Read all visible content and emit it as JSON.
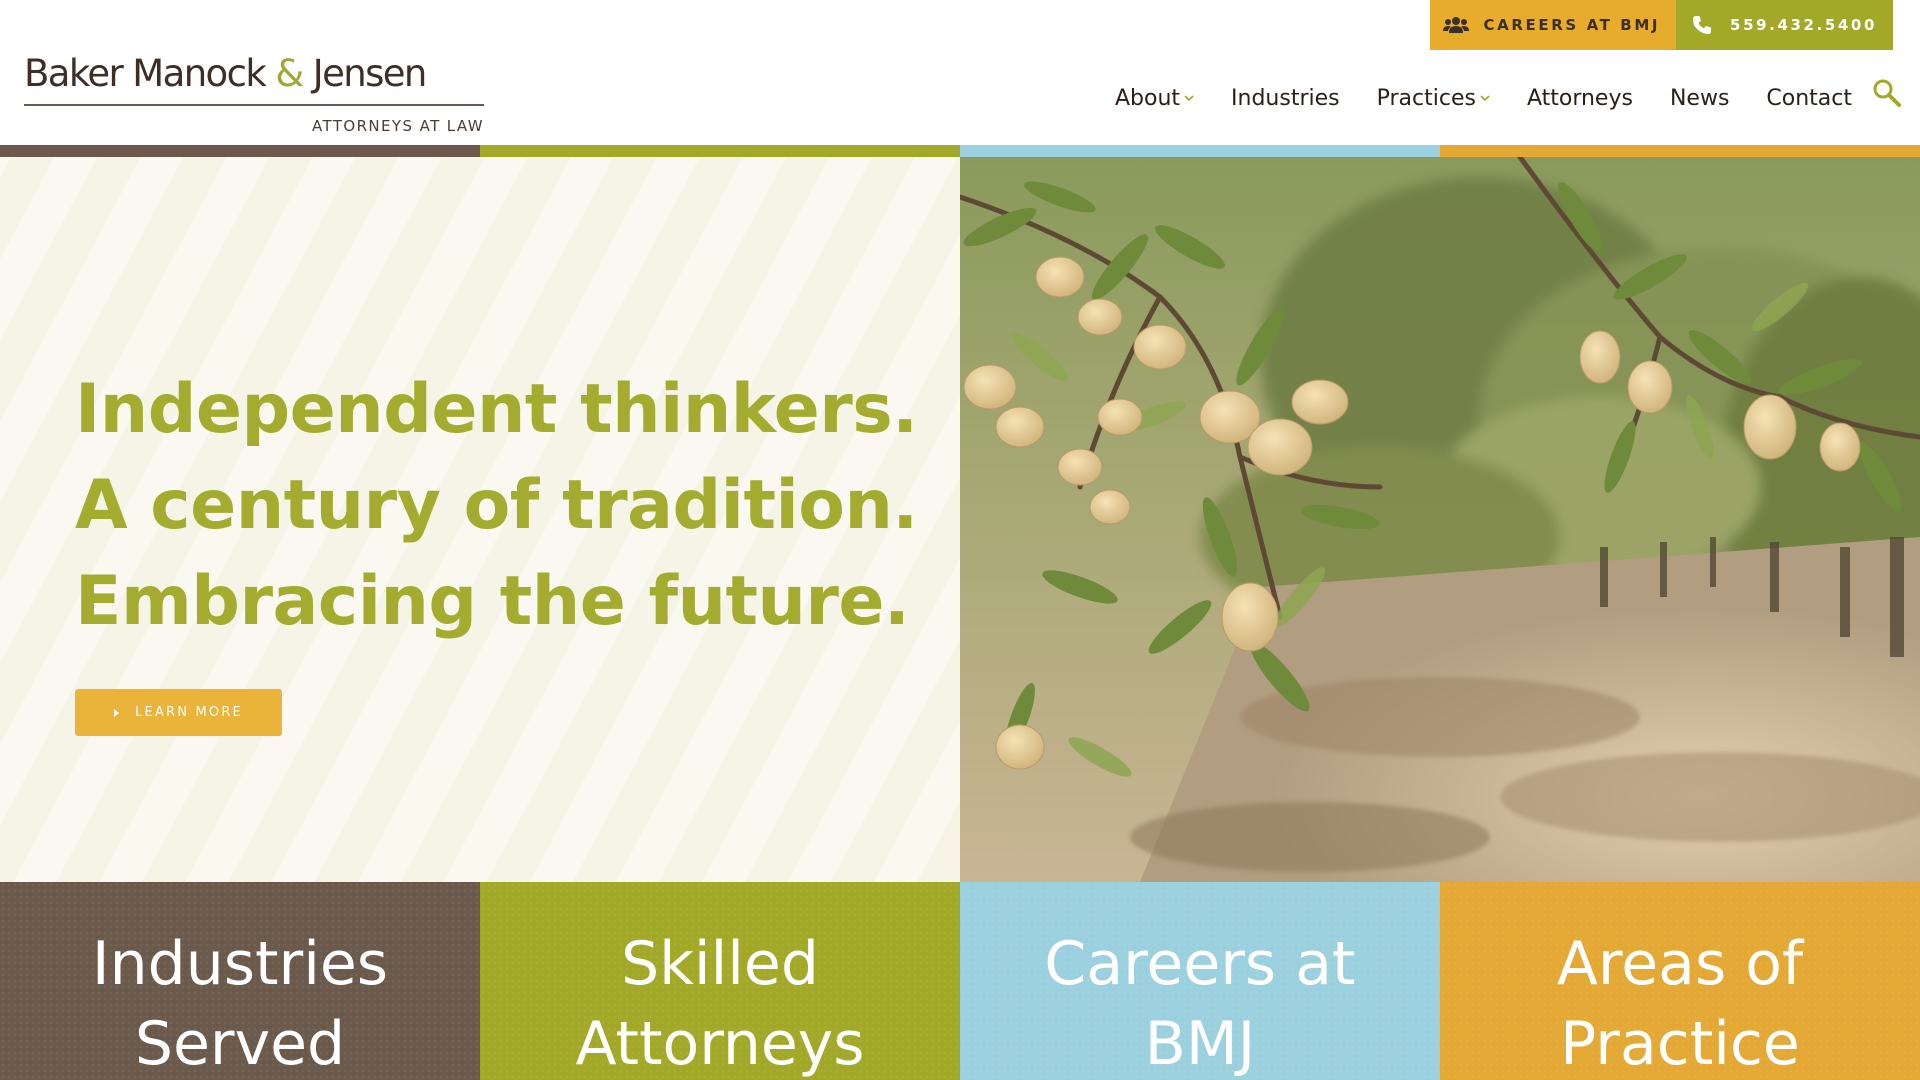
{
  "brand": {
    "name_part1": "Baker Manock",
    "amp": "&",
    "name_part2": "Jensen",
    "subtitle": "ATTORNEYS AT LAW"
  },
  "topbar": {
    "careers_label": "CAREERS AT BMJ",
    "phone_label": "559.432.5400"
  },
  "nav": {
    "items": [
      {
        "label": "About",
        "has_dropdown": true
      },
      {
        "label": "Industries",
        "has_dropdown": false
      },
      {
        "label": "Practices",
        "has_dropdown": true
      },
      {
        "label": "Attorneys",
        "has_dropdown": false
      },
      {
        "label": "News",
        "has_dropdown": false
      },
      {
        "label": "Contact",
        "has_dropdown": false
      }
    ],
    "search_icon": "search-icon"
  },
  "hero": {
    "lines": [
      "Independent thinkers.",
      "A century of tradition.",
      "Embracing the future."
    ],
    "cta_label": "LEARN MORE",
    "image": "almond-orchard-photo"
  },
  "tiles": [
    {
      "line1": "Industries",
      "line2": "Served"
    },
    {
      "line1": "Skilled",
      "line2": "Attorneys"
    },
    {
      "line1": "Careers at",
      "line2": "BMJ"
    },
    {
      "line1": "Areas of",
      "line2": "Practice"
    }
  ],
  "colors": {
    "brown": "#6b5a4c",
    "olive": "#a2a928",
    "sky": "#9bd0de",
    "gold": "#e4a834",
    "headline": "#a4ac2f",
    "cream": "#f6f4e6"
  }
}
